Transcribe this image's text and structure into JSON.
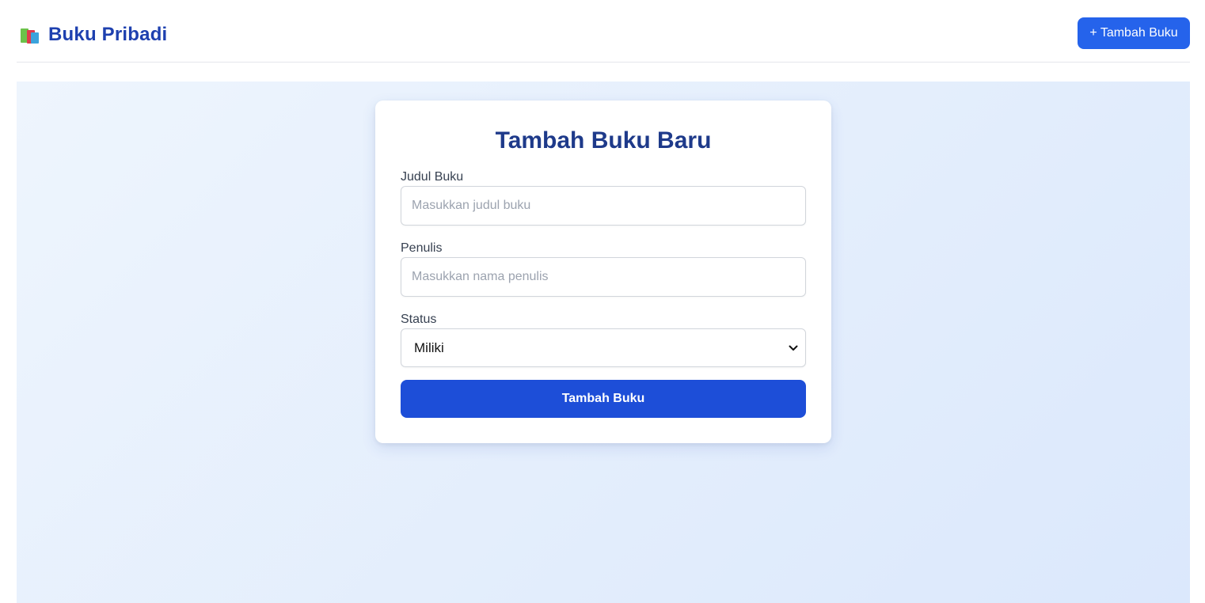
{
  "header": {
    "brand_icon": "books-icon",
    "brand_title": "Buku Pribadi",
    "add_button_label": "+ Tambah Buku"
  },
  "form": {
    "title": "Tambah Buku Baru",
    "title_field": {
      "label": "Judul Buku",
      "value": "",
      "placeholder": "Masukkan judul buku"
    },
    "author_field": {
      "label": "Penulis",
      "value": "",
      "placeholder": "Masukkan nama penulis"
    },
    "status_field": {
      "label": "Status",
      "selected": "Miliki"
    },
    "submit_label": "Tambah Buku"
  },
  "colors": {
    "brand": "#1e40af",
    "primary_button": "#2563eb",
    "submit_button": "#1d4ed8",
    "title": "#1e3a8a",
    "background_gradient_start": "#eef5fd",
    "background_gradient_end": "#dbe8fc"
  }
}
